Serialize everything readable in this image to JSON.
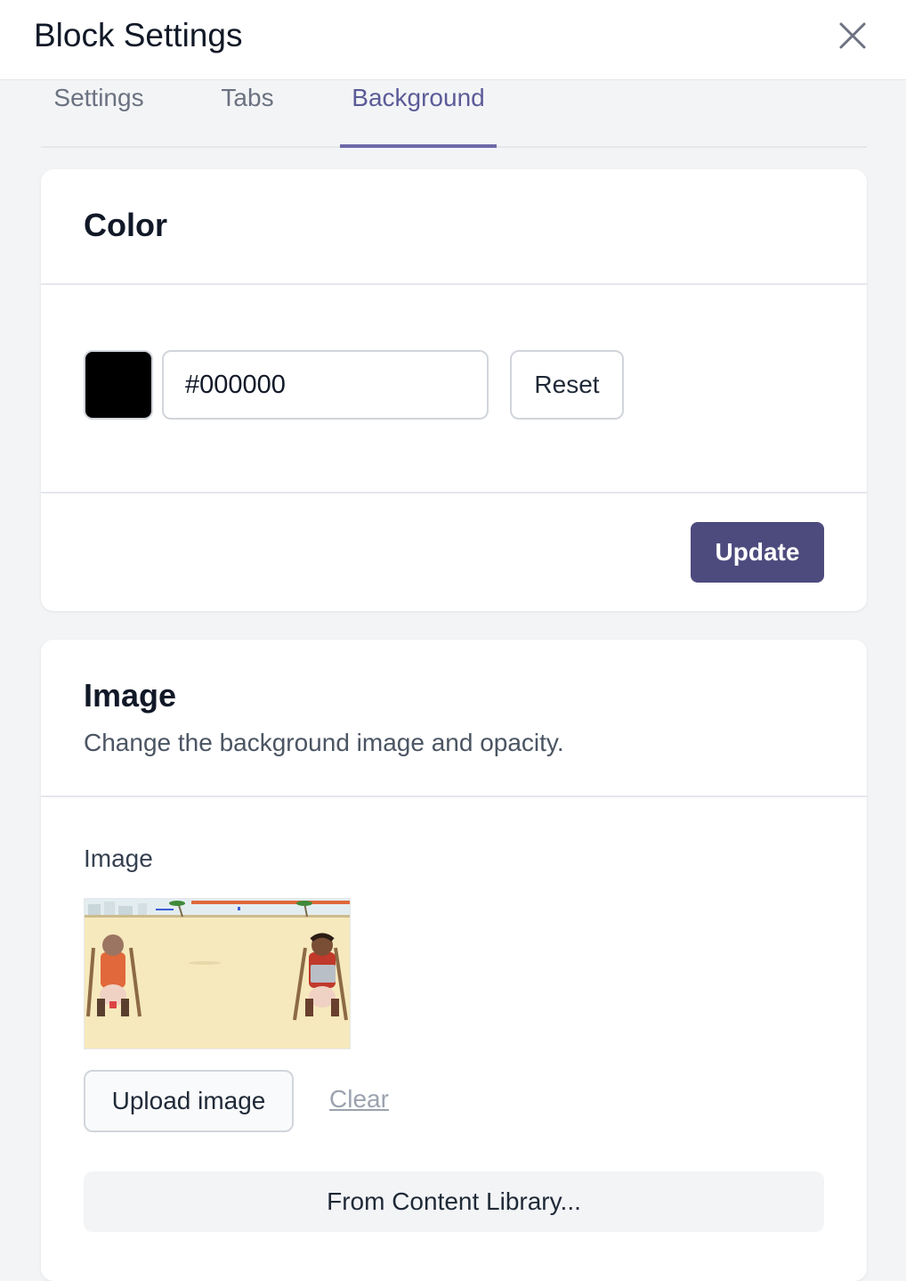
{
  "header": {
    "title": "Block Settings",
    "close_icon": "close-icon"
  },
  "tabs": [
    {
      "label": "Settings",
      "active": false
    },
    {
      "label": "Tabs",
      "active": false
    },
    {
      "label": "Background",
      "active": true
    }
  ],
  "color_section": {
    "title": "Color",
    "swatch_color": "#000000",
    "hex_value": "#000000",
    "reset_label": "Reset",
    "update_label": "Update"
  },
  "image_section": {
    "title": "Image",
    "description": "Change the background image and opacity.",
    "field_label": "Image",
    "upload_label": "Upload image",
    "clear_label": "Clear",
    "library_label": "From Content Library..."
  },
  "colors": {
    "accent": "#4d4b7e",
    "active_tab": "#5b5b98",
    "page_bg": "#f3f4f6"
  }
}
